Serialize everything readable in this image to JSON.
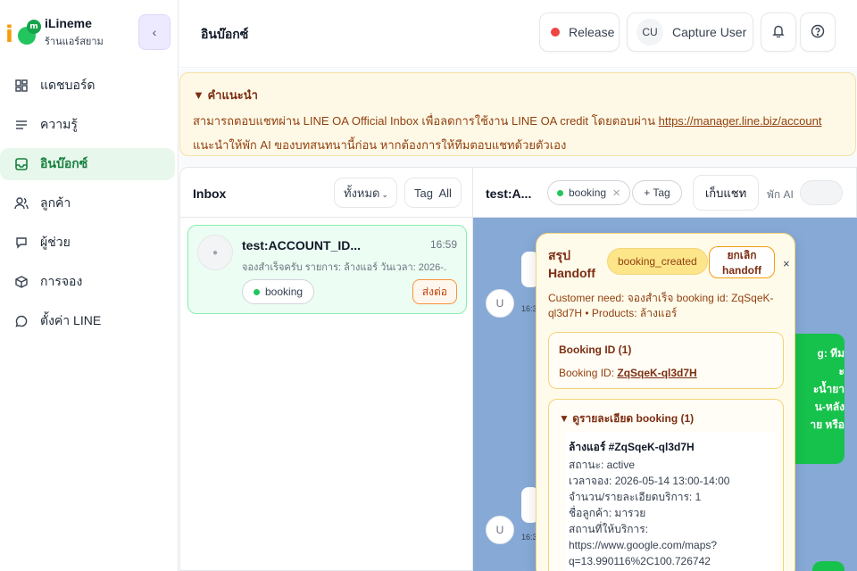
{
  "brand": {
    "name": "iLineme",
    "shop": "ร้านแอร์สยาม"
  },
  "sidebar": {
    "items": [
      {
        "label": "แดชบอร์ด",
        "icon": "dashboard-icon"
      },
      {
        "label": "ความรู้",
        "icon": "knowledge-icon"
      },
      {
        "label": "อินบ๊อกซ์",
        "icon": "inbox-icon",
        "active": true
      },
      {
        "label": "ลูกค้า",
        "icon": "users-icon"
      },
      {
        "label": "ผู้ช่วย",
        "icon": "chat-bubble-icon"
      },
      {
        "label": "การจอง",
        "icon": "box-icon"
      },
      {
        "label": "ตั้งค่า LINE",
        "icon": "message-circle-icon"
      }
    ]
  },
  "header": {
    "title": "อินบ๊อกซ์",
    "release_label": "Release",
    "user_initials": "CU",
    "user_label": "Capture User"
  },
  "tip": {
    "title": "▼ คำแนะนำ",
    "line1": "สามารถตอบแชทผ่าน LINE OA Official Inbox เพื่อลดการใช้งาน LINE OA credit โดยตอบผ่าน ",
    "link": "https://manager.line.biz/account",
    "line2": "แนะนำให้พัก AI ของบทสนทนานี้ก่อน หากต้องการให้ทีมตอบแชทด้วยตัวเอง"
  },
  "inbox": {
    "title": "Inbox",
    "filter_all": "ทั้งหมด",
    "filter_tag": "Tag  All",
    "conversations": [
      {
        "name": "test:ACCOUNT_ID...",
        "time": "16:59",
        "preview": "จองสำเร็จครับ รายการ: ล้างแอร์ วันเวลา: 2026-...",
        "tag": "booking",
        "action": "ส่งต่อ"
      }
    ]
  },
  "chat": {
    "name": "test:A...",
    "tag": "booking",
    "add_tag": "+ Tag",
    "archive": "เก็บแชท",
    "pause_ai": "พัก AI",
    "messages": [
      {
        "avatar": "U",
        "time": "16:3"
      },
      {
        "avatar": "U",
        "time": "16:3"
      }
    ],
    "bot_bubble_lines": [
      "g: ทีม",
      "ะ",
      "ะน้ำยา",
      "น-หลัง",
      "าย หรือ"
    ]
  },
  "handoff": {
    "title": "สรุป Handoff",
    "badge": "booking_created",
    "cancel_line1": "ยกเลิก",
    "cancel_line2": "handoff",
    "close": "×",
    "need": "Customer need: จองสำเร็จ booking id: ZqSqeK-ql3d7H • Products: ล้างแอร์",
    "booking_card": {
      "heading": "Booking ID (1)",
      "label": "Booking ID: ",
      "id": "ZqSqeK-ql3d7H"
    },
    "detail_card": {
      "heading": "▼ ดูรายละเอียด booking (1)",
      "title": "ล้างแอร์ #ZqSqeK-ql3d7H",
      "lines": [
        "สถานะ: active",
        "เวลาจอง: 2026-05-14 13:00-14:00",
        "จำนวน/รายละเอียดบริการ: 1",
        "ชื่อลูกค้า: มารวย",
        "สถานที่ให้บริการ:",
        "https://www.google.com/maps?",
        "q=13.990116%2C100.726742"
      ]
    }
  }
}
